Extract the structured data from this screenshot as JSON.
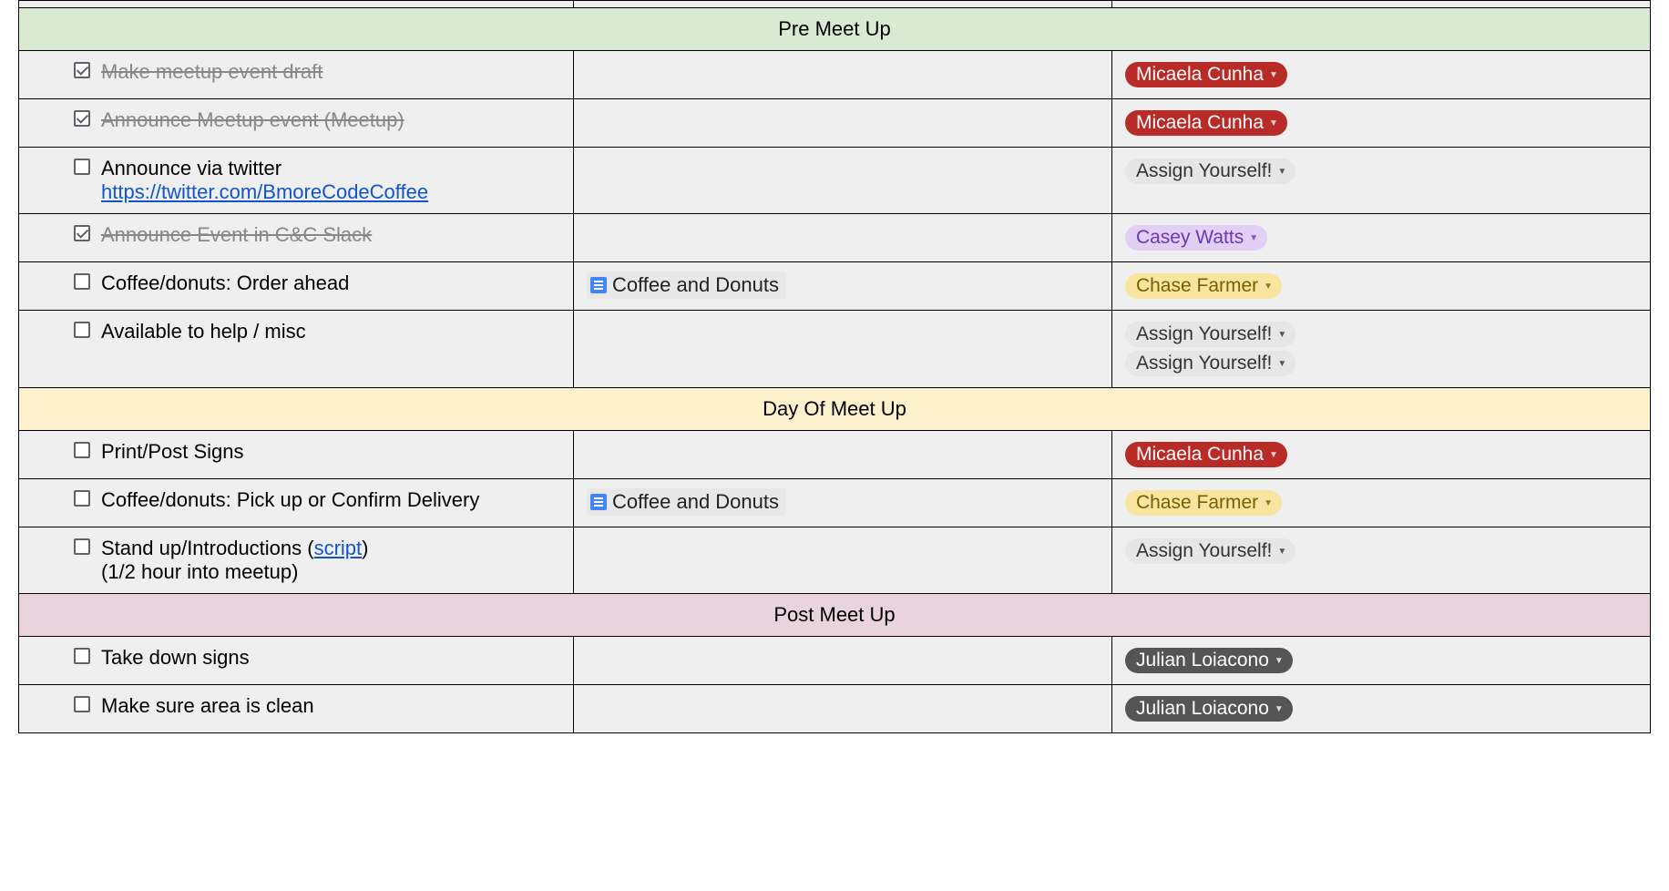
{
  "sections": {
    "pre": {
      "title": "Pre Meet Up"
    },
    "day": {
      "title": "Day Of Meet Up"
    },
    "post": {
      "title": "Post Meet Up"
    }
  },
  "tasks": {
    "pre": [
      {
        "checked": true,
        "text": "Make meetup event draft",
        "done": true,
        "link": null,
        "sub": null,
        "doc": null,
        "assignees": [
          {
            "name": "Micaela Cunha",
            "style": "red"
          }
        ]
      },
      {
        "checked": true,
        "text": "Announce Meetup event (Meetup)",
        "done": true,
        "link": null,
        "sub": null,
        "doc": null,
        "assignees": [
          {
            "name": "Micaela Cunha",
            "style": "red"
          }
        ]
      },
      {
        "checked": false,
        "text": "Announce via twitter",
        "done": false,
        "link": "https://twitter.com/BmoreCodeCoffee",
        "sub": null,
        "doc": null,
        "assignees": [
          {
            "name": "Assign Yourself!",
            "style": "gray"
          }
        ]
      },
      {
        "checked": true,
        "text": "Announce Event in C&C Slack",
        "done": true,
        "link": null,
        "sub": null,
        "doc": null,
        "assignees": [
          {
            "name": "Casey Watts",
            "style": "purple"
          }
        ]
      },
      {
        "checked": false,
        "text": "Coffee/donuts: Order ahead",
        "done": false,
        "link": null,
        "sub": null,
        "doc": "Coffee and Donuts",
        "assignees": [
          {
            "name": "Chase Farmer",
            "style": "yellow"
          }
        ]
      },
      {
        "checked": false,
        "text": "Available to help / misc",
        "done": false,
        "link": null,
        "sub": null,
        "doc": null,
        "assignees": [
          {
            "name": "Assign Yourself!",
            "style": "gray"
          },
          {
            "name": "Assign Yourself!",
            "style": "gray"
          }
        ]
      }
    ],
    "day": [
      {
        "checked": false,
        "text": "Print/Post Signs",
        "done": false,
        "link": null,
        "sub": null,
        "doc": null,
        "assignees": [
          {
            "name": "Micaela Cunha",
            "style": "red"
          }
        ]
      },
      {
        "checked": false,
        "text": "Coffee/donuts: Pick up or Confirm Delivery",
        "done": false,
        "link": null,
        "sub": null,
        "doc": "Coffee and Donuts",
        "assignees": [
          {
            "name": "Chase Farmer",
            "style": "yellow"
          }
        ]
      },
      {
        "checked": false,
        "text": "Stand up/Introductions (",
        "done": false,
        "link": null,
        "scriptLink": "script",
        "afterScript": ")",
        "sub": "(1/2 hour into meetup)",
        "doc": null,
        "assignees": [
          {
            "name": "Assign Yourself!",
            "style": "gray"
          }
        ]
      }
    ],
    "post": [
      {
        "checked": false,
        "text": "Take down signs",
        "done": false,
        "link": null,
        "sub": null,
        "doc": null,
        "assignees": [
          {
            "name": "Julian Loiacono",
            "style": "dark"
          }
        ]
      },
      {
        "checked": false,
        "text": "Make sure area is clean",
        "done": false,
        "link": null,
        "sub": null,
        "doc": null,
        "assignees": [
          {
            "name": "Julian Loiacono",
            "style": "dark"
          }
        ]
      }
    ]
  }
}
